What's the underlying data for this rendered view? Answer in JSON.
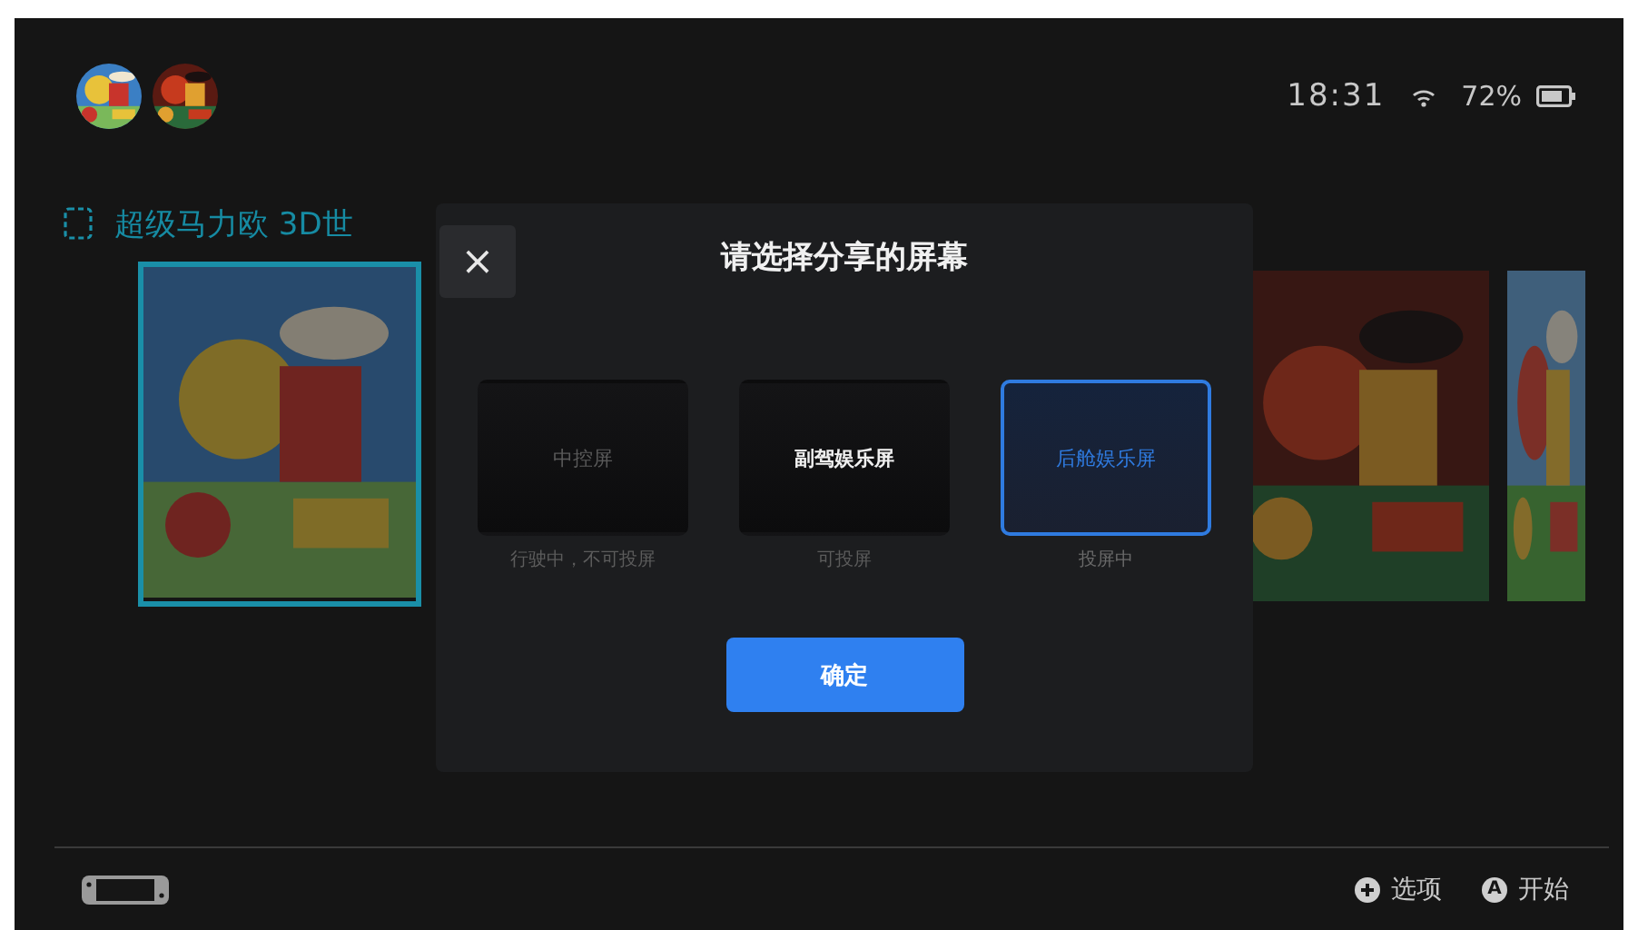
{
  "status_bar": {
    "avatars": [
      {
        "kind": "picture"
      },
      {
        "kind": "picture"
      }
    ],
    "time": "18:31",
    "battery": "72%"
  },
  "game_title": "超级马力欧 3D世",
  "game_cards": [
    {
      "kind": "picture",
      "selected": true
    },
    {
      "kind": "picture",
      "selected": false
    },
    {
      "kind": "picture",
      "selected": false
    }
  ],
  "dialog": {
    "close": "×",
    "title": "请选择分享的屏幕",
    "options": [
      {
        "label": "中控屏",
        "caption": "行驶中，不可投屏",
        "selected": false,
        "disabled": true
      },
      {
        "label": "副驾娱乐屏",
        "caption": "可投屏",
        "selected": false,
        "disabled": false
      },
      {
        "label": "后舱娱乐屏",
        "caption": "投屏中",
        "selected": true,
        "disabled": false
      }
    ],
    "confirm": "确定"
  },
  "footer": {
    "hints": [
      {
        "kind": "plus",
        "label": "选项"
      },
      {
        "kind": "letter",
        "key": "A",
        "label": "开始"
      }
    ]
  }
}
